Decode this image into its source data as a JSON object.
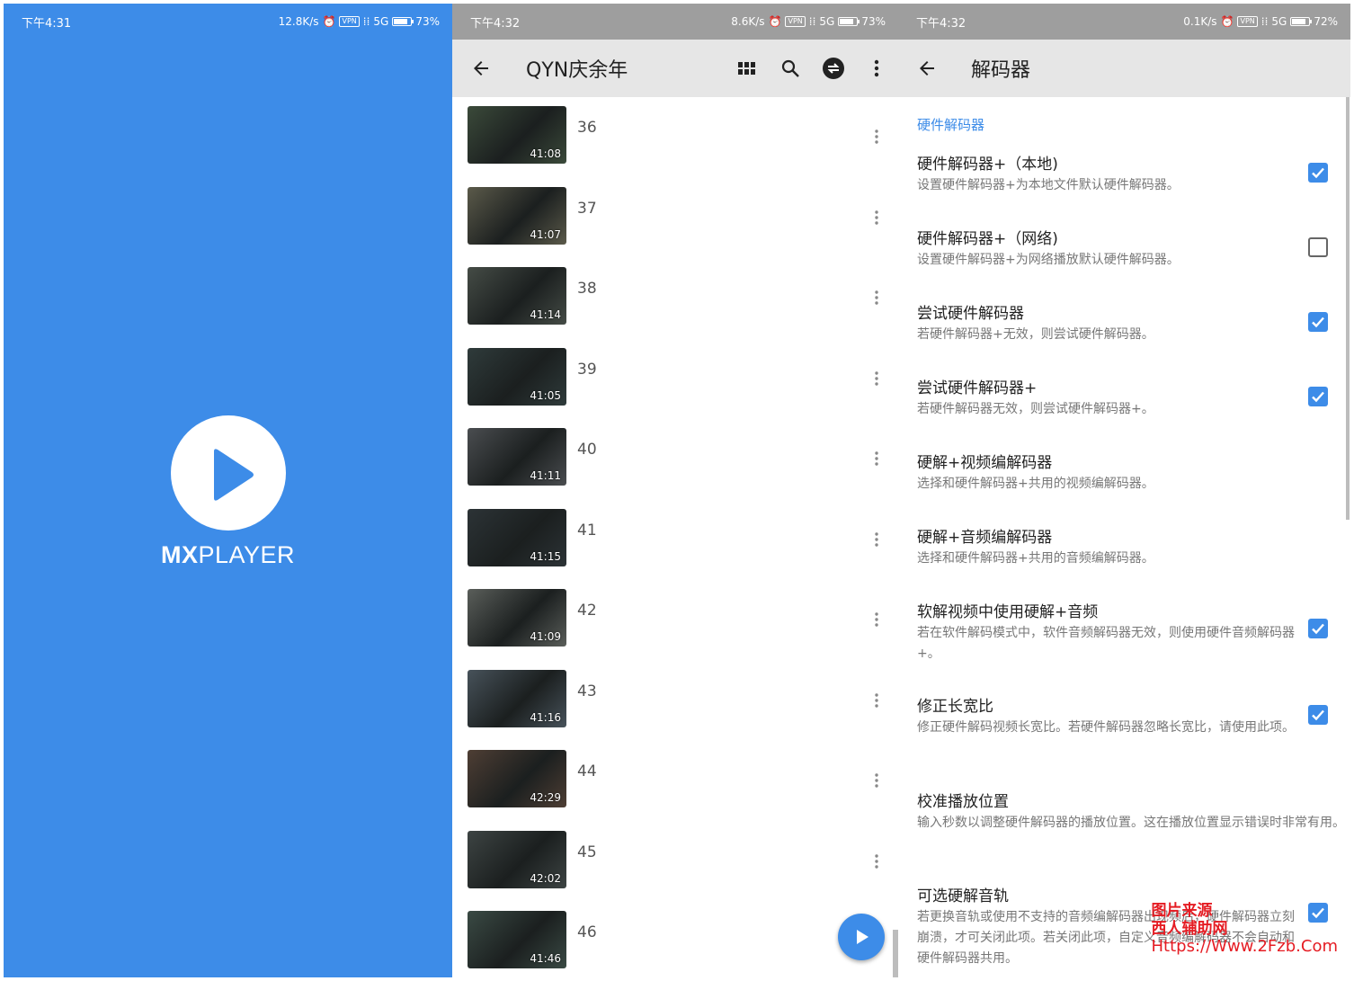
{
  "splash": {
    "status": {
      "time": "下午4:31",
      "speed": "12.8K/s",
      "vpn": "VPN",
      "network": "5G",
      "battery": "73%",
      "battery_fraction": 0.73
    },
    "brand_bold": "MX",
    "brand_light": "PLAYER",
    "background_color": "#3d8ce8"
  },
  "list": {
    "status": {
      "time": "下午4:32",
      "speed": "8.6K/s",
      "vpn": "VPN",
      "network": "5G",
      "battery": "73%",
      "battery_fraction": 0.73
    },
    "title": "QYN庆余年",
    "toolbar_icons": [
      "back-arrow-icon",
      "grid-view-icon",
      "search-icon",
      "network-stream-icon",
      "more-vert-icon"
    ],
    "videos": [
      {
        "number": "36",
        "duration": "41:08"
      },
      {
        "number": "37",
        "duration": "41:07"
      },
      {
        "number": "38",
        "duration": "41:14"
      },
      {
        "number": "39",
        "duration": "41:05"
      },
      {
        "number": "40",
        "duration": "41:11"
      },
      {
        "number": "41",
        "duration": "41:15"
      },
      {
        "number": "42",
        "duration": "41:09"
      },
      {
        "number": "43",
        "duration": "41:16"
      },
      {
        "number": "44",
        "duration": "42:29"
      },
      {
        "number": "45",
        "duration": "42:02"
      },
      {
        "number": "46",
        "duration": "41:46"
      }
    ]
  },
  "settings": {
    "status": {
      "time": "下午4:32",
      "speed": "0.1K/s",
      "vpn": "VPN",
      "network": "5G",
      "battery": "72%",
      "battery_fraction": 0.72
    },
    "title": "解码器",
    "section": "硬件解码器",
    "prefs": [
      {
        "title": "硬件解码器+（本地)",
        "summary": "设置硬件解码器+为本地文件默认硬件解码器。",
        "checkbox": true,
        "checked": true
      },
      {
        "title": "硬件解码器+（网络)",
        "summary": "设置硬件解码器+为网络播放默认硬件解码器。",
        "checkbox": true,
        "checked": false
      },
      {
        "title": "尝试硬件解码器",
        "summary": "若硬件解码器+无效，则尝试硬件解码器。",
        "checkbox": true,
        "checked": true
      },
      {
        "title": "尝试硬件解码器+",
        "summary": "若硬件解码器无效，则尝试硬件解码器+。",
        "checkbox": true,
        "checked": true
      },
      {
        "title": "硬解+视频编解码器",
        "summary": "选择和硬件解码器+共用的视频编解码器。",
        "checkbox": false,
        "checked": false
      },
      {
        "title": "硬解+音频编解码器",
        "summary": "选择和硬件解码器+共用的音频编解码器。",
        "checkbox": false,
        "checked": false
      },
      {
        "title": "软解视频中使用硬解+音频",
        "summary": "若在软件解码模式中，软件音频解码器无效，则使用硬件音频解码器+。",
        "checkbox": true,
        "checked": true
      },
      {
        "title": "修正长宽比",
        "summary": "修正硬件解码视频长宽比。若硬件解码器忽略长宽比，请使用此项。",
        "checkbox": true,
        "checked": true
      },
      {
        "title": "校准播放位置",
        "summary": "输入秒数以调整硬件解码器的播放位置。这在播放位置显示错误时非常有用。",
        "checkbox": false,
        "checked": false
      },
      {
        "title": "可选硬解音轨",
        "summary": "若更换音轨或使用不支持的音频编解码器出现频后，硬件解码器立刻崩溃，才可关闭此项。若关闭此项，自定义音频编解码器不会自动和硬件解码器共用。",
        "checkbox": true,
        "checked": true
      }
    ]
  },
  "watermark": {
    "line1": "图片来源",
    "line2": "西人辅助网",
    "url": "Https://Www.2Fzb.Com"
  },
  "colors": {
    "accent": "#3d8ce8",
    "appbar": "#e6e6e6",
    "statusbar": "#9e9e9e",
    "watermark": "#e51c23"
  }
}
